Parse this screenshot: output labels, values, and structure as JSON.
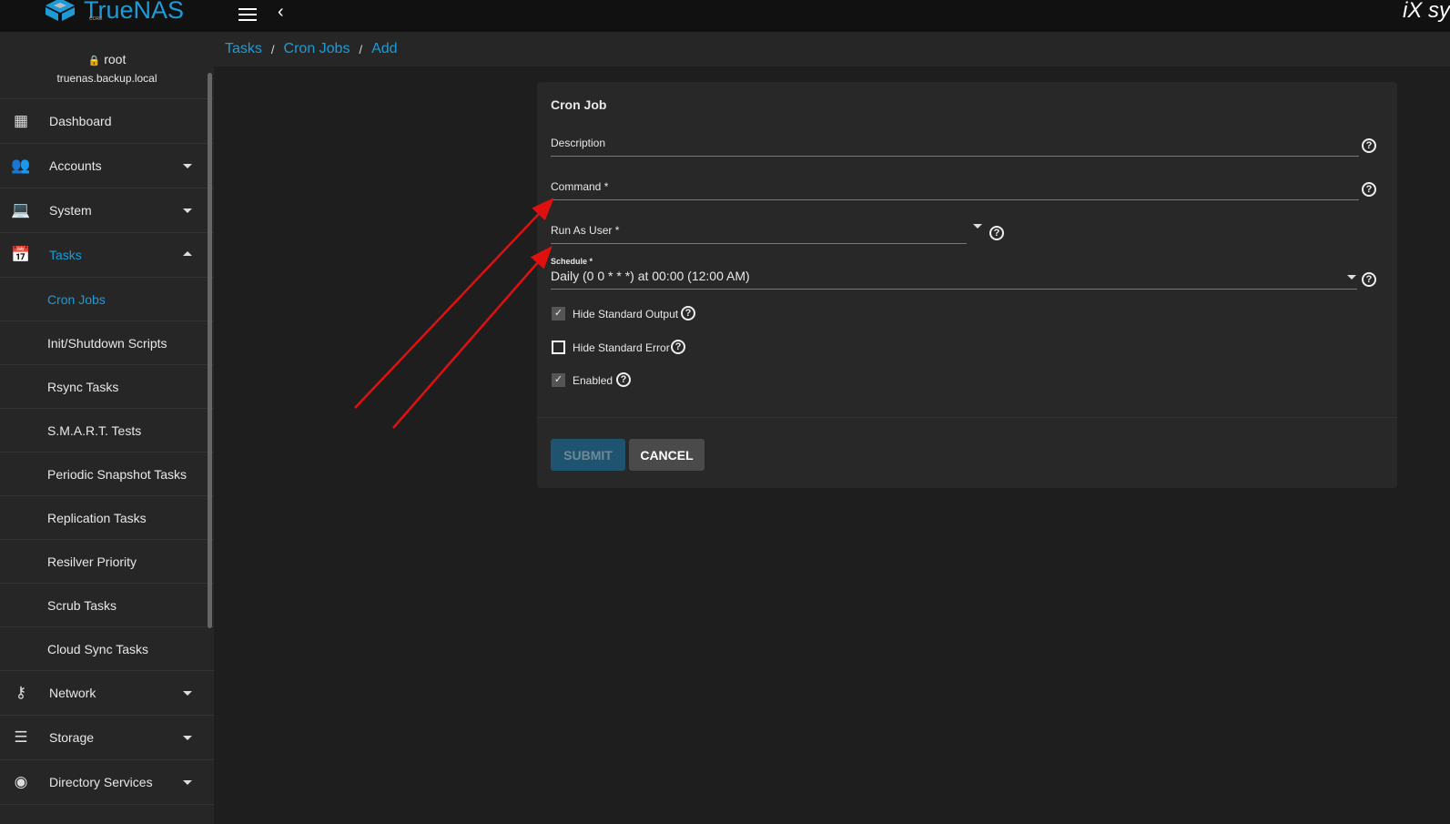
{
  "topbar": {
    "logo": "TrueNAS",
    "logo_sub": "CORE",
    "vendor_logo": "iX sy"
  },
  "user": {
    "name": "root",
    "host": "truenas.backup.local"
  },
  "nav": {
    "dashboard": "Dashboard",
    "accounts": "Accounts",
    "system": "System",
    "tasks": "Tasks",
    "network": "Network",
    "storage": "Storage",
    "directory": "Directory Services"
  },
  "tasks_sub": [
    "Cron Jobs",
    "Init/Shutdown Scripts",
    "Rsync Tasks",
    "S.M.A.R.T. Tests",
    "Periodic Snapshot Tasks",
    "Replication Tasks",
    "Resilver Priority",
    "Scrub Tasks",
    "Cloud Sync Tasks"
  ],
  "breadcrumb": [
    "Tasks",
    "Cron Jobs",
    "Add"
  ],
  "form": {
    "title": "Cron Job",
    "description_label": "Description",
    "command_label": "Command *",
    "user_label": "Run As User *",
    "schedule_label": "Schedule *",
    "schedule_value": "Daily (0 0 * * *) at 00:00 (12:00 AM)",
    "hide_stdout": "Hide Standard Output",
    "hide_stdout_checked": true,
    "hide_stderr": "Hide Standard Error",
    "hide_stderr_checked": false,
    "enabled": "Enabled",
    "enabled_checked": true,
    "submit": "SUBMIT",
    "cancel": "CANCEL"
  },
  "colors": {
    "accent": "#1d9bd7",
    "arrow": "#e01010"
  }
}
